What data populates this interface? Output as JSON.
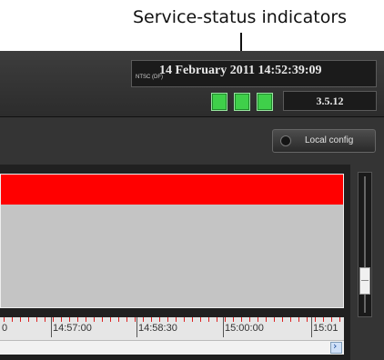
{
  "callout": {
    "label": "Service-status indicators"
  },
  "header": {
    "datetime": "14 February 2011 14:52:39:09",
    "video_mode": "NTSC (DF)",
    "indicators": [
      "service-1",
      "service-2",
      "service-3"
    ],
    "indicator_color": "#3fd04a",
    "version": "3.5.12"
  },
  "toolbar": {
    "local_config_label": "Local config"
  },
  "timeline": {
    "bar_color": "#ff0000",
    "ticks": [
      "14:57:00",
      "14:58:30",
      "15:00:00",
      "15:01"
    ]
  }
}
